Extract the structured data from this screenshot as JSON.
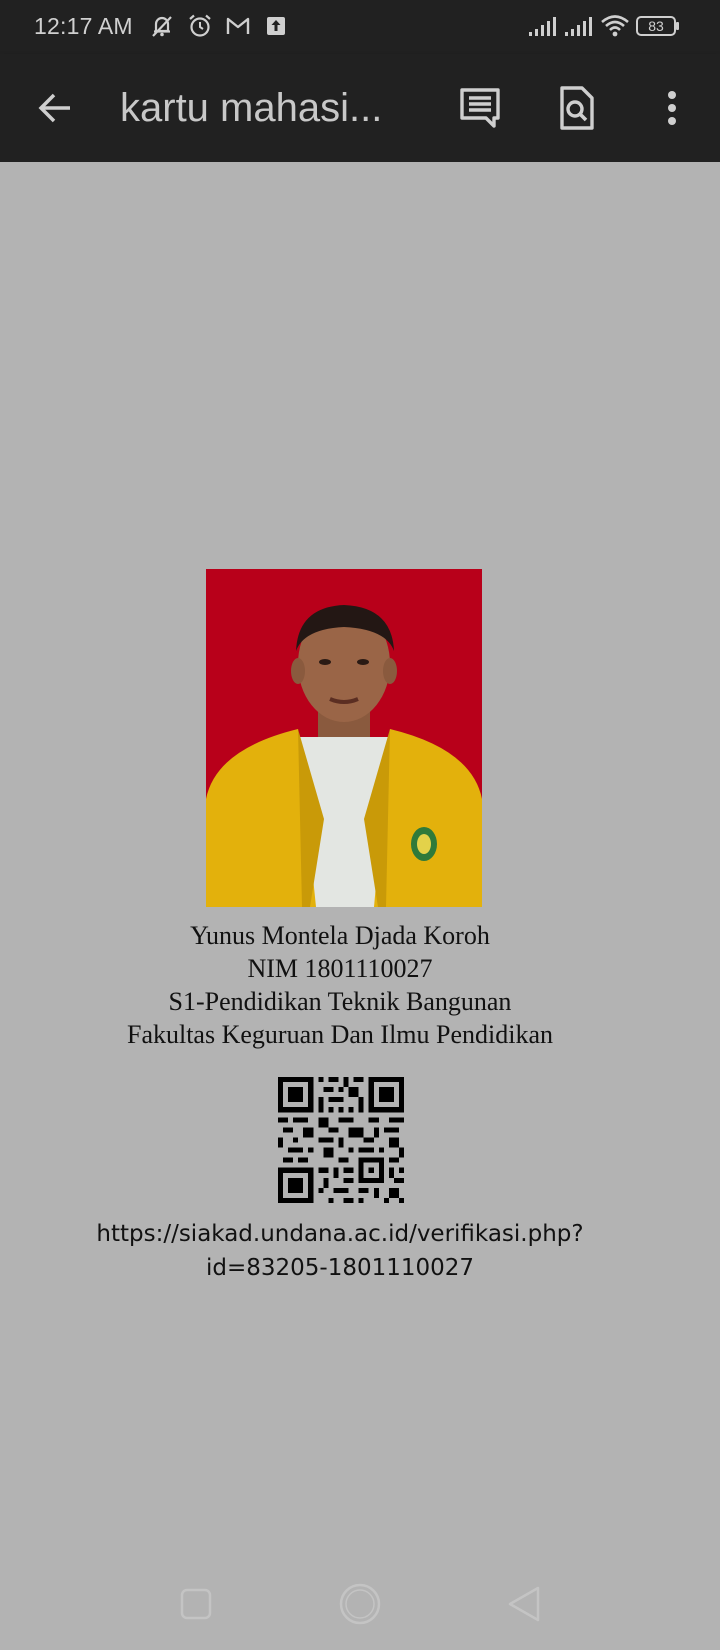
{
  "status_bar": {
    "time": "12:17 AM",
    "battery": "83",
    "icons": [
      "notifications-off-icon",
      "alarm-icon",
      "gmail-icon",
      "upload-icon",
      "signal-icon",
      "signal-icon",
      "wifi-icon",
      "battery-icon"
    ]
  },
  "toolbar": {
    "title": "kartu mahasi...",
    "back_icon": "arrow-back-icon",
    "comments_icon": "comments-icon",
    "find_icon": "find-in-page-icon",
    "more_icon": "more-vert-icon"
  },
  "document": {
    "photo_background": "#b8001a",
    "name": "Yunus Montela Djada Koroh",
    "nim": "NIM 1801110027",
    "program": "S1-Pendidikan Teknik Bangunan",
    "faculty": "Fakultas Keguruan Dan Ilmu Pendidikan",
    "verify_url_line1": "https://siakad.undana.ac.id/verifikasi.php?",
    "verify_url_line2": "id=83205-1801110027"
  },
  "colors": {
    "bar_background": "#212121",
    "page_background": "#b3b3b3",
    "jacket": "#e3b10c"
  }
}
